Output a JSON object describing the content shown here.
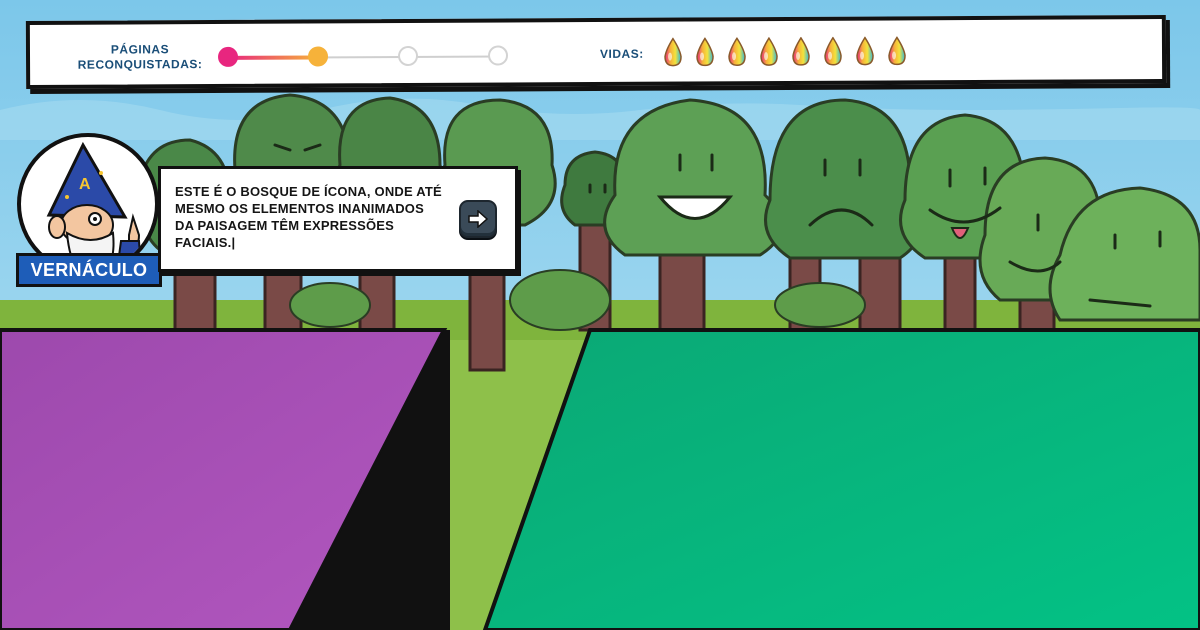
{
  "hud": {
    "pages_label_line1": "PÁGINAS",
    "pages_label_line2": "RECONQUISTADAS:",
    "pages_total": 4,
    "pages_progress_step": 2,
    "lives_label": "VIDAS:",
    "lives_count": 8
  },
  "character": {
    "name": "VERNÁCULO",
    "hat_letter": "A"
  },
  "dialog": {
    "text": "ESTE É O BOSQUE DE ÍCONA, ONDE ATÉ MESMO OS ELEMENTOS INANIMADOS DA PAISAGEM TÊM EXPRESSÕES FACIAIS.|",
    "next_icon": "arrow-right-icon"
  },
  "colors": {
    "sky": "#8fd0ec",
    "purple_panel": "#a24cb0",
    "green_panel": "#08b57a",
    "progress_start": "#e8267f",
    "progress_end": "#f6b23a",
    "name_tag": "#1e5db8"
  }
}
